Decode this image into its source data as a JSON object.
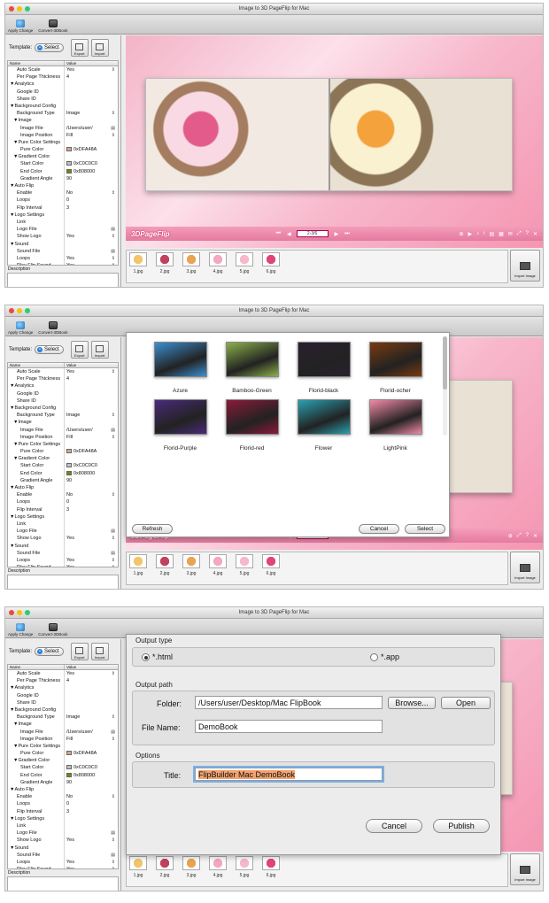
{
  "window": {
    "title": "Image to 3D PageFlip for Mac"
  },
  "toolbar": {
    "apply": "Apply Change",
    "convert": "Convert-3DBook"
  },
  "template": {
    "label": "Template:",
    "select": "Select",
    "export": "Export",
    "import": "Import"
  },
  "props": {
    "header": {
      "name": "Name",
      "value": "Value"
    },
    "rows": [
      {
        "n": "Auto Scale",
        "v": "Yes",
        "dd": "⇕",
        "i": 2
      },
      {
        "n": "Per Page Thickness",
        "v": "4",
        "i": 2
      },
      {
        "n": "▼Analytics",
        "v": "",
        "i": 0
      },
      {
        "n": "Google ID",
        "v": "",
        "i": 2
      },
      {
        "n": "Share ID",
        "v": "",
        "i": 2
      },
      {
        "n": "▼Background Config",
        "v": "",
        "i": 0
      },
      {
        "n": "Background Type",
        "v": "Image",
        "dd": "⇕",
        "i": 2
      },
      {
        "n": "▼Image",
        "v": "",
        "i": 1
      },
      {
        "n": "Image File",
        "v": "/Users/user/",
        "dd": "▤",
        "i": 3
      },
      {
        "n": "Image Position",
        "v": "Fill",
        "dd": "⇕",
        "i": 3
      },
      {
        "n": "▼Pure Color Settings",
        "v": "",
        "i": 1
      },
      {
        "n": "Pure Color",
        "v": "0xDFA48A",
        "sw": "#DFA48A",
        "i": 3
      },
      {
        "n": "▼Gradient Color",
        "v": "",
        "i": 1
      },
      {
        "n": "Start Color",
        "v": "0xC0C0C0",
        "sw": "#C0C0C0",
        "i": 3
      },
      {
        "n": "End Color",
        "v": "0x808000",
        "sw": "#808000",
        "i": 3
      },
      {
        "n": "Gradient Angle",
        "v": "90",
        "i": 3
      },
      {
        "n": "▼Auto Flip",
        "v": "",
        "i": 0
      },
      {
        "n": "Enable",
        "v": "No",
        "dd": "⇕",
        "i": 2
      },
      {
        "n": "Loops",
        "v": "0",
        "i": 2
      },
      {
        "n": "Flip Interval",
        "v": "3",
        "i": 2
      },
      {
        "n": "▼Logo Settings",
        "v": "",
        "i": 0
      },
      {
        "n": "Link",
        "v": "",
        "i": 2
      },
      {
        "n": "Logo File",
        "v": "",
        "dd": "▤",
        "i": 2
      },
      {
        "n": "Show Logo",
        "v": "Yes",
        "dd": "⇕",
        "i": 2
      },
      {
        "n": "▼Sound",
        "v": "",
        "i": 0
      },
      {
        "n": "Sound File",
        "v": "",
        "dd": "▤",
        "i": 2
      },
      {
        "n": "Loops",
        "v": "Yes",
        "dd": "⇕",
        "i": 2
      },
      {
        "n": "Play Flip Sound",
        "v": "Yes",
        "dd": "⇕",
        "i": 2
      }
    ]
  },
  "description": {
    "label": "Description"
  },
  "viewer": {
    "logo": "3DPageFlip",
    "page": "2-3/6",
    "colors": {
      "nav": "#e57ba0"
    }
  },
  "thumbs": [
    {
      "label": "1.jpg",
      "color": "#f1c66a"
    },
    {
      "label": "2.jpg",
      "color": "#c0415e"
    },
    {
      "label": "3.jpg",
      "color": "#e8a454"
    },
    {
      "label": "4.jpg",
      "color": "#f2a9c0"
    },
    {
      "label": "5.jpg",
      "color": "#f5b9c9"
    },
    {
      "label": "6.jpg",
      "color": "#e0457a"
    }
  ],
  "import_image": "Import Image",
  "templates_dialog": {
    "items": [
      {
        "name": "Azure",
        "color": "#3a8fd0"
      },
      {
        "name": "Bamboo-Green",
        "color": "#8bb04a"
      },
      {
        "name": "Florid-black",
        "color": "#2a2030"
      },
      {
        "name": "Florid-ocher",
        "color": "#7a3a10"
      },
      {
        "name": "Florid-Purple",
        "color": "#4a2a7a"
      },
      {
        "name": "Florid-red",
        "color": "#8a1a3a"
      },
      {
        "name": "Flower",
        "color": "#2aa0b0"
      },
      {
        "name": "LightPink",
        "color": "#f28aa8"
      }
    ],
    "refresh": "Refresh",
    "cancel": "Cancel",
    "select": "Select"
  },
  "output_dialog": {
    "output_type": "Output type",
    "html": "*.html",
    "app": "*.app",
    "output_path": "Output path",
    "folder_label": "Folder:",
    "folder_value": "/Users/user/Desktop/Mac FlipBook",
    "browse": "Browse...",
    "open": "Open",
    "filename_label": "File Name:",
    "filename_value": "DemoBook",
    "options": "Options",
    "title_label": "Title:",
    "title_value": "FlipBuilder Mac DemoBook",
    "cancel": "Cancel",
    "publish": "Publish"
  }
}
